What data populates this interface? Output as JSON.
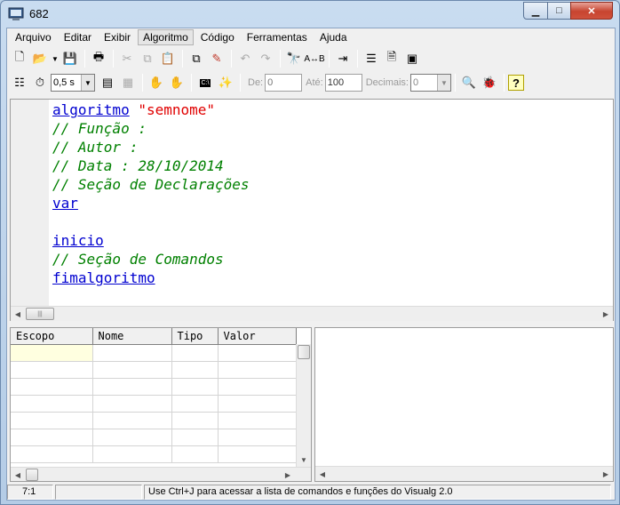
{
  "window": {
    "title": "682"
  },
  "menu": [
    "Arquivo",
    "Editar",
    "Exibir",
    "Algoritmo",
    "Código",
    "Ferramentas",
    "Ajuda"
  ],
  "toolbar2": {
    "speed_value": "0,5 s",
    "de_label": "De:",
    "de_value": "0",
    "ate_label": "Até:",
    "ate_value": "100",
    "decimais_label": "Decimais:",
    "decimais_value": "0"
  },
  "editor": {
    "lines": [
      [
        {
          "t": "algoritmo",
          "c": "kw"
        },
        {
          "t": " "
        },
        {
          "t": "\"semnome\"",
          "c": "str"
        }
      ],
      [
        {
          "t": "// Função :",
          "c": "cm"
        }
      ],
      [
        {
          "t": "// Autor :",
          "c": "cm"
        }
      ],
      [
        {
          "t": "// Data : 28/10/2014",
          "c": "cm"
        }
      ],
      [
        {
          "t": "// Seção de Declarações",
          "c": "cm"
        }
      ],
      [
        {
          "t": "var",
          "c": "kw"
        }
      ],
      [],
      [
        {
          "t": "inicio",
          "c": "kw"
        }
      ],
      [
        {
          "t": "// Seção de Comandos",
          "c": "cm"
        }
      ],
      [
        {
          "t": "fimalgoritmo",
          "c": "kw"
        }
      ]
    ]
  },
  "variables_grid": {
    "columns": [
      "Escopo",
      "Nome",
      "Tipo",
      "Valor"
    ],
    "row_count": 7
  },
  "statusbar": {
    "position": "7:1",
    "middle": "",
    "message": "Use Ctrl+J para acessar a lista de comandos e funções do Visualg 2.0"
  }
}
